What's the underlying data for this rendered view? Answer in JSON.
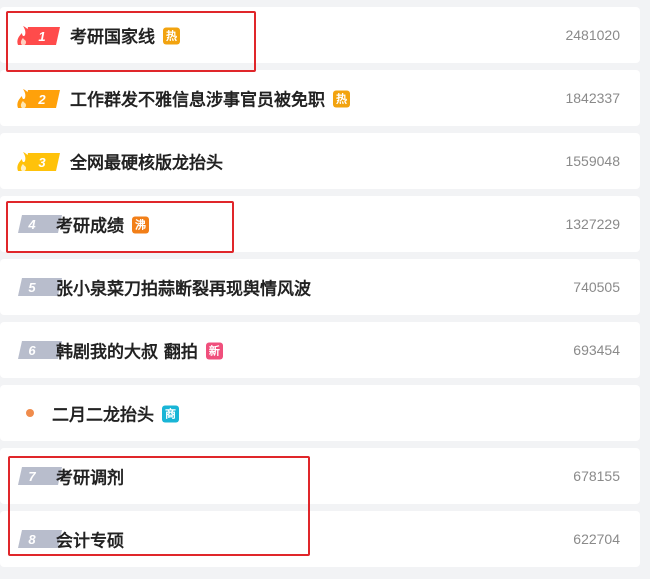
{
  "colors": {
    "hot_badge": "#f2a30f",
    "boil_badge": "#f27f18",
    "new_badge": "#f04f7c",
    "promo_badge": "#19b5d6",
    "rank_gray": "#b8bdcc",
    "rank1": "#ff4b4b",
    "rank2": "#ffa10a",
    "rank3": "#ffc20a",
    "highlight": "#e0262a",
    "promo_dot": "#f08c4c"
  },
  "items": [
    {
      "rank": "1",
      "title": "考研国家线",
      "badge": "热",
      "badge_type": "hot",
      "count": "2481020",
      "rank_style": "flame-red"
    },
    {
      "rank": "2",
      "title": "工作群发不雅信息涉事官员被免职",
      "badge": "热",
      "badge_type": "hot",
      "count": "1842337",
      "rank_style": "flame-orange"
    },
    {
      "rank": "3",
      "title": "全网最硬核版龙抬头",
      "badge": "",
      "badge_type": "",
      "count": "1559048",
      "rank_style": "flame-yellow"
    },
    {
      "rank": "4",
      "title": "考研成绩",
      "badge": "沸",
      "badge_type": "boil",
      "count": "1327229",
      "rank_style": "gray"
    },
    {
      "rank": "5",
      "title": "张小泉菜刀拍蒜断裂再现舆情风波",
      "badge": "",
      "badge_type": "",
      "count": "740505",
      "rank_style": "gray"
    },
    {
      "rank": "6",
      "title": "韩剧我的大叔 翻拍",
      "badge": "新",
      "badge_type": "new",
      "count": "693454",
      "rank_style": "gray"
    },
    {
      "rank": "",
      "title": "二月二龙抬头",
      "badge": "商",
      "badge_type": "promo",
      "count": "",
      "rank_style": "dot"
    },
    {
      "rank": "7",
      "title": "考研调剂",
      "badge": "",
      "badge_type": "",
      "count": "678155",
      "rank_style": "gray"
    },
    {
      "rank": "8",
      "title": "会计专硕",
      "badge": "",
      "badge_type": "",
      "count": "622704",
      "rank_style": "gray"
    }
  ]
}
